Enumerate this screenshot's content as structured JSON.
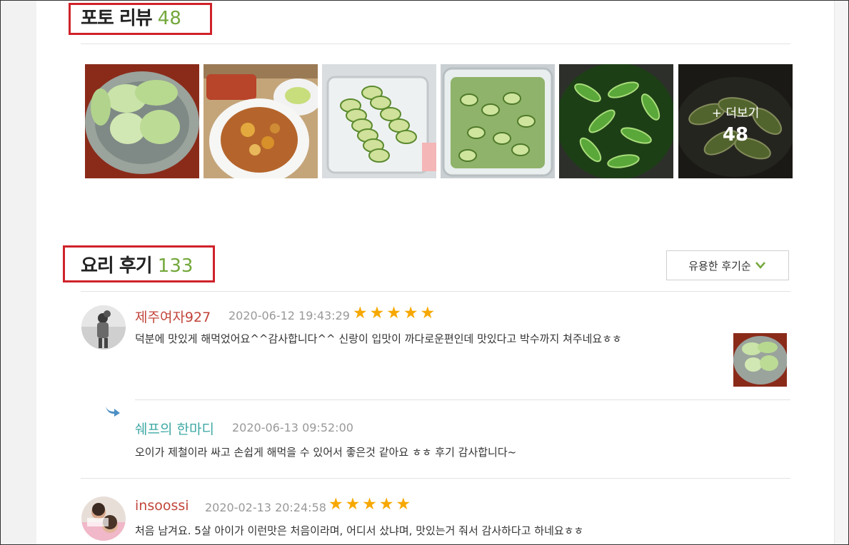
{
  "photo_reviews": {
    "title": "포토 리뷰",
    "count": "48",
    "thumbnails": [
      {
        "name": "cucumber-plate"
      },
      {
        "name": "curry-bowl"
      },
      {
        "name": "sliced-cucumber-container"
      },
      {
        "name": "cucumber-salad-container"
      },
      {
        "name": "cucumber-pot"
      },
      {
        "name": "cucumber-dish"
      }
    ],
    "more_label": "+ 더보기",
    "more_count": "48"
  },
  "cooking_reviews": {
    "title": "요리 후기",
    "count": "133",
    "sort": {
      "label": "유용한 후기순",
      "icon": "chevron-down-icon"
    },
    "reviews": [
      {
        "nickname": "제주여자927",
        "date": "2020-06-12 19:43:29",
        "stars": "★★★★★",
        "rating": 5,
        "text": "덕분에 맛있게 해먹었어요^^감사합니다^^ 신랑이 입맛이 까다로운편인데 맛있다고 박수까지 쳐주네요ㅎㅎ",
        "reply": {
          "author": "쉐프의 한마디",
          "date": "2020-06-13 09:52:00",
          "text": "오이가 제철이라 싸고 손쉽게 해먹을 수 있어서 좋은것 같아요 ㅎㅎ 후기 감사합니다~"
        }
      },
      {
        "nickname": "insoossi",
        "date": "2020-02-13 20:24:58",
        "stars": "★★★★★",
        "rating": 5,
        "text": "처음 남겨요. 5살 아이가 이런맛은 처음이라며, 어디서 샀냐며, 맛있는거 줘서 감사하다고 하네요ㅎㅎ"
      }
    ]
  },
  "colors": {
    "count_green": "#74a83c",
    "nickname_red": "#c1453a",
    "chef_teal": "#3fa9a4",
    "star_gold": "#f7a800",
    "highlight_red": "#d0222a"
  }
}
